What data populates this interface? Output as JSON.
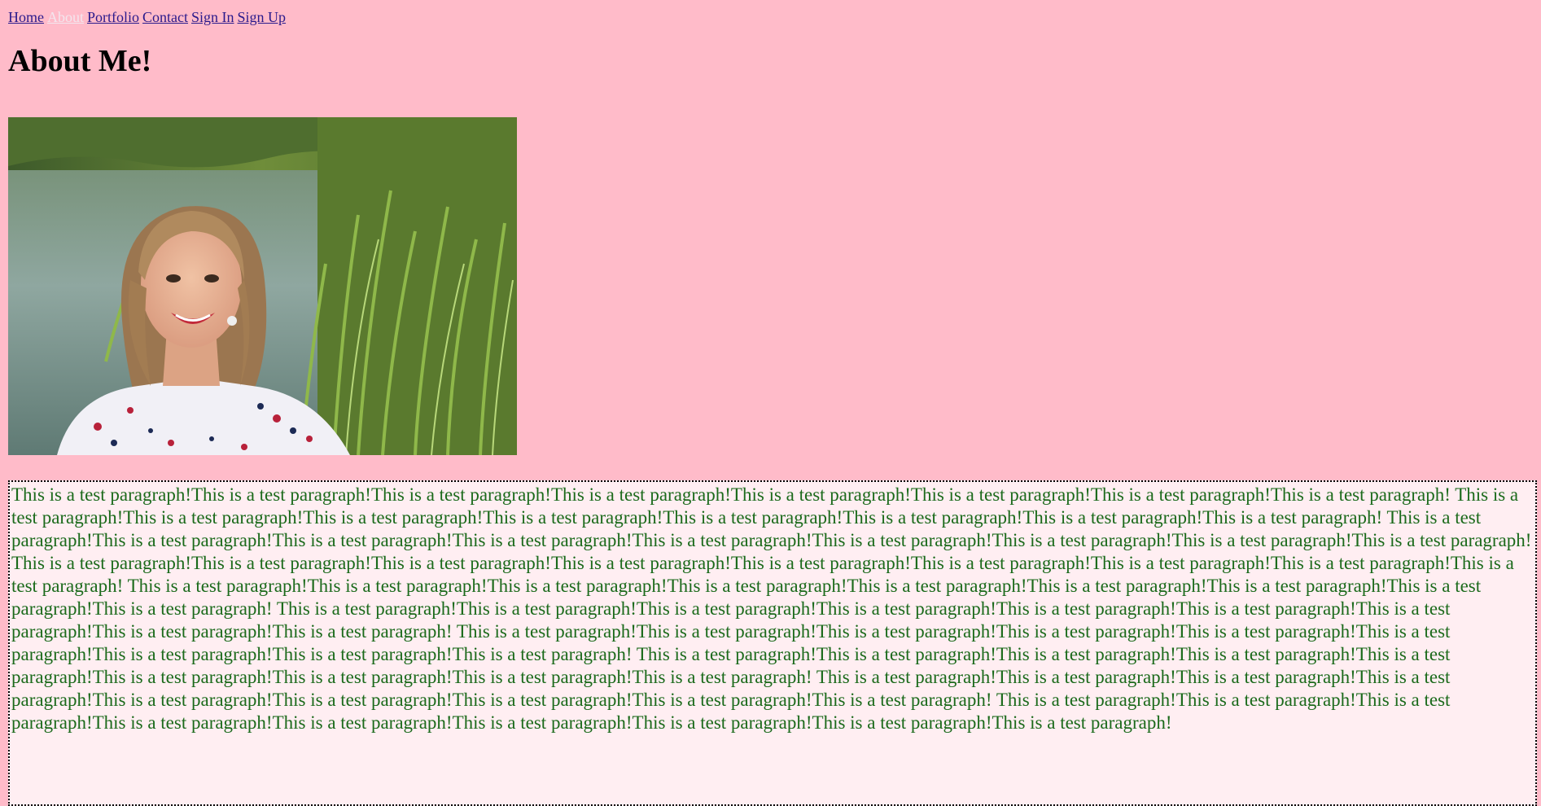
{
  "nav": {
    "items": [
      {
        "label": "Home",
        "active": false
      },
      {
        "label": "About",
        "active": true
      },
      {
        "label": "Portfolio",
        "active": false
      },
      {
        "label": "Contact",
        "active": false
      },
      {
        "label": "Sign In",
        "active": false
      },
      {
        "label": "Sign Up",
        "active": false
      }
    ]
  },
  "page": {
    "title": "About Me!"
  },
  "photo": {
    "subject": "portrait-photo"
  },
  "content": {
    "paragraph": "This is a test paragraph!This is a test paragraph!This is a test paragraph!This is a test paragraph!This is a test paragraph!This is a test paragraph!This is a test paragraph!This is a test paragraph! This is a test paragraph!This is a test paragraph!This is a test paragraph!This is a test paragraph!This is a test paragraph!This is a test paragraph!This is a test paragraph!This is a test paragraph! This is a test paragraph!This is a test paragraph!This is a test paragraph!This is a test paragraph!This is a test paragraph!This is a test paragraph!This is a test paragraph!This is a test paragraph!This is a test paragraph! This is a test paragraph!This is a test paragraph!This is a test paragraph!This is a test paragraph!This is a test paragraph!This is a test paragraph!This is a test paragraph!This is a test paragraph!This is a test paragraph! This is a test paragraph!This is a test paragraph!This is a test paragraph!This is a test paragraph!This is a test paragraph!This is a test paragraph!This is a test paragraph!This is a test paragraph!This is a test paragraph! This is a test paragraph!This is a test paragraph!This is a test paragraph!This is a test paragraph!This is a test paragraph!This is a test paragraph!This is a test paragraph!This is a test paragraph!This is a test paragraph! This is a test paragraph!This is a test paragraph!This is a test paragraph!This is a test paragraph!This is a test paragraph!This is a test paragraph!This is a test paragraph!This is a test paragraph!This is a test paragraph! This is a test paragraph!This is a test paragraph!This is a test paragraph!This is a test paragraph!This is a test paragraph!This is a test paragraph!This is a test paragraph!This is a test paragraph!This is a test paragraph! This is a test paragraph!This is a test paragraph!This is a test paragraph!This is a test paragraph!This is a test paragraph!This is a test paragraph!This is a test paragraph!This is a test paragraph!This is a test paragraph! This is a test paragraph!This is a test paragraph!This is a test paragraph!This is a test paragraph!This is a test paragraph!This is a test paragraph!This is a test paragraph!This is a test paragraph!This is a test paragraph!"
  },
  "colors": {
    "background": "#ffbbc9",
    "link": "#2a1a8c",
    "active_link": "#f3e6ee",
    "paragraph_text": "#1b6a1b",
    "paragraph_bg": "#ffeef2"
  }
}
